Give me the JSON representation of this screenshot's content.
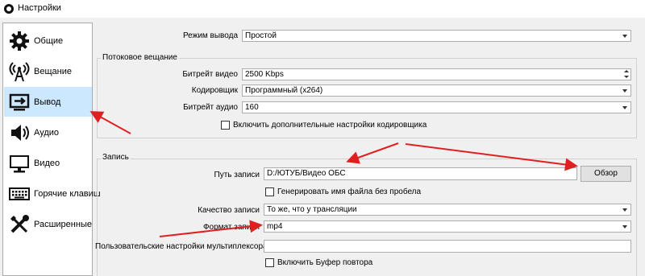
{
  "window": {
    "title": "Настройки"
  },
  "sidebar": {
    "items": [
      {
        "label": "Общие",
        "icon": "gear-icon"
      },
      {
        "label": "Вещание",
        "icon": "broadcast-antenna-icon"
      },
      {
        "label": "Вывод",
        "icon": "output-icon"
      },
      {
        "label": "Аудио",
        "icon": "speaker-icon"
      },
      {
        "label": "Видео",
        "icon": "monitor-icon"
      },
      {
        "label": "Горячие клавиш",
        "icon": "keyboard-icon"
      },
      {
        "label": "Расширенные",
        "icon": "tools-icon"
      }
    ],
    "active_index": 2
  },
  "output_mode": {
    "label": "Режим вывода",
    "value": "Простой"
  },
  "streaming": {
    "title": "Потоковое вещание",
    "video_bitrate": {
      "label": "Битрейт видео",
      "value": "2500 Kbps"
    },
    "encoder": {
      "label": "Кодировщик",
      "value": "Программный (x264)"
    },
    "audio_bitrate": {
      "label": "Битрейт аудио",
      "value": "160"
    },
    "advanced_checkbox": {
      "label": "Включить дополнительные настройки кодировщика",
      "checked": false
    }
  },
  "recording": {
    "title": "Запись",
    "path": {
      "label": "Путь записи",
      "value": "D:/ЮТУБ/Видео ОБС"
    },
    "browse_button": "Обзор",
    "no_space_checkbox": {
      "label": "Генерировать имя файла без пробела",
      "checked": false
    },
    "quality": {
      "label": "Качество записи",
      "value": "То же, что у трансляции"
    },
    "format": {
      "label": "Формат записи",
      "value": "mp4"
    },
    "muxer": {
      "label": "Пользовательские настройки мультиплексора",
      "value": ""
    },
    "replay_buffer_checkbox": {
      "label": "Включить Буфер повтора",
      "checked": false
    }
  },
  "colors": {
    "annotation_arrow": "#e02020",
    "active_item": "#cce8ff"
  }
}
